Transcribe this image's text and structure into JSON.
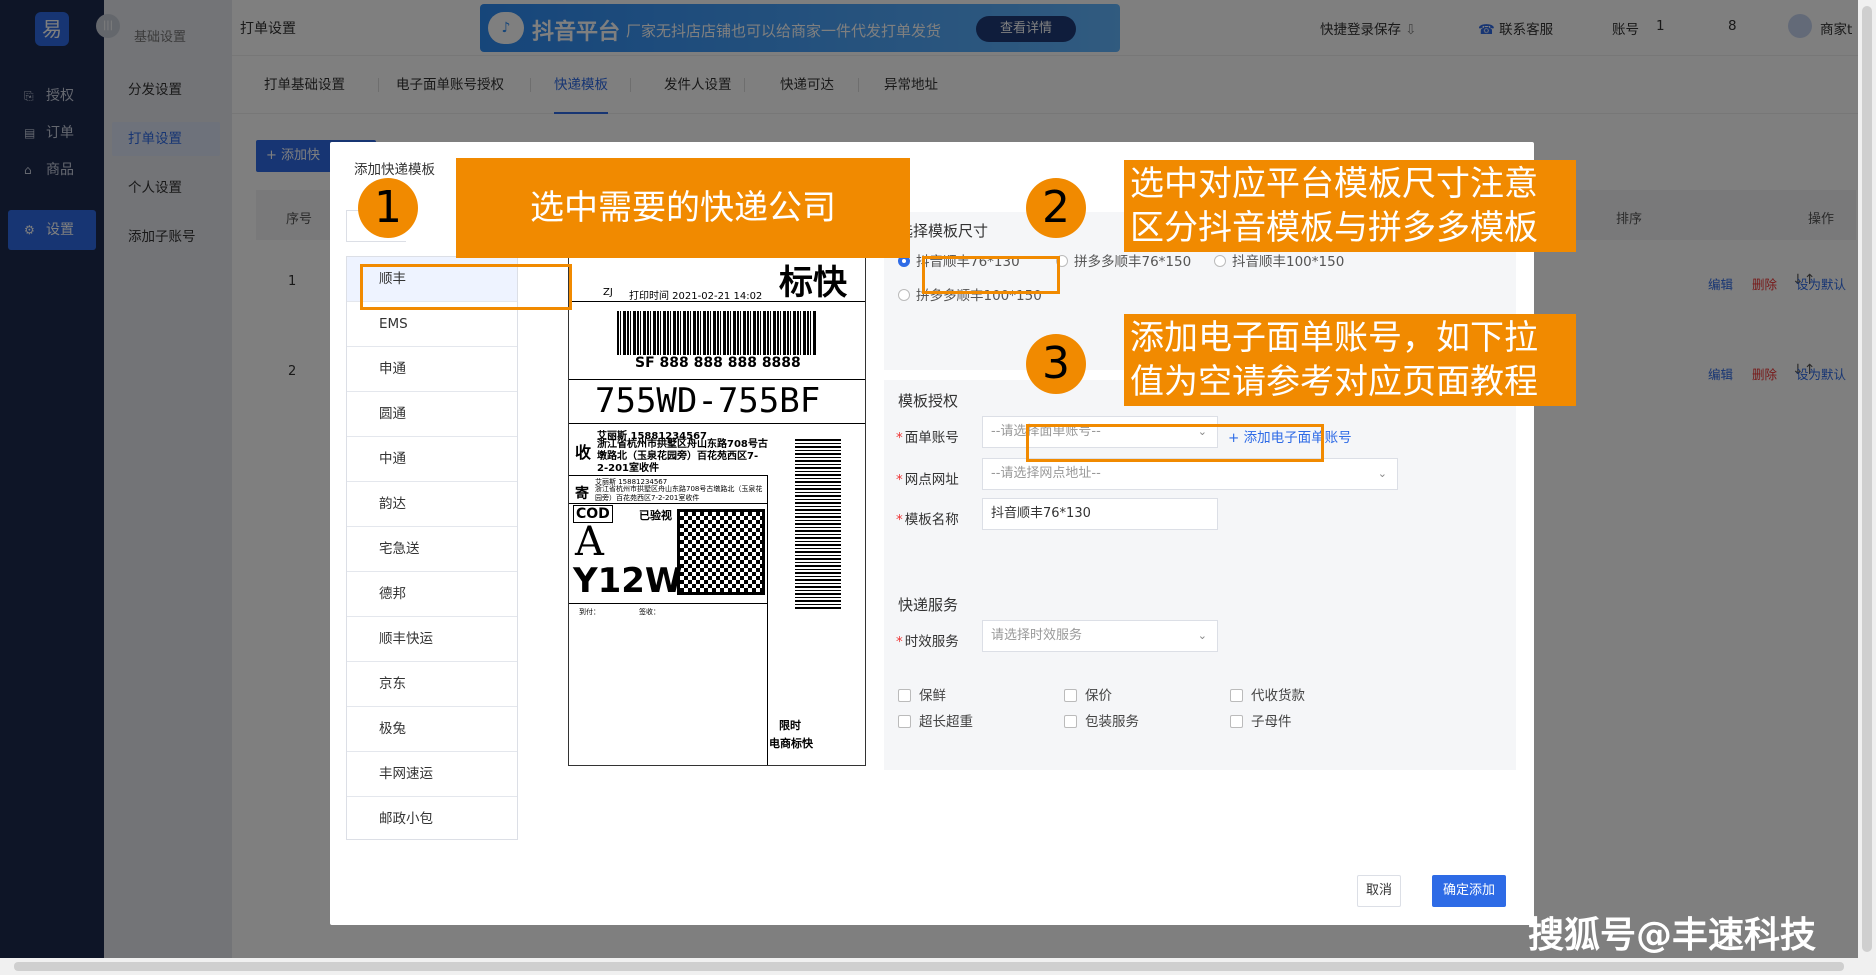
{
  "nav": {
    "logo": "易",
    "items": [
      {
        "label": "授权",
        "icon": "auth-icon"
      },
      {
        "label": "订单",
        "icon": "order-icon"
      },
      {
        "label": "商品",
        "icon": "goods-icon"
      },
      {
        "label": "设置",
        "icon": "settings-icon"
      }
    ],
    "collapse": "|||"
  },
  "subnav": {
    "heading": "基础设置",
    "items": [
      "分发设置",
      "打单设置",
      "个人设置",
      "添加子账号"
    ]
  },
  "header": {
    "title": "打单设置",
    "banner": {
      "title": "抖音平台",
      "text": "厂家无抖店店铺也可以给商家一件代发打单发货",
      "button": "查看详情"
    },
    "quick_login": "快捷登录保存",
    "support": "联系客服",
    "account_label": "账号",
    "account_value": "1",
    "count": "8",
    "user": "商家t"
  },
  "tabs": [
    "打单基础设置",
    "电子面单账号授权",
    "快递模板",
    "发件人设置",
    "快递可达",
    "异常地址"
  ],
  "page": {
    "add_button": "+ 添加快",
    "table_headers": {
      "no": "序号",
      "sort": "排序",
      "ops": "操作"
    },
    "rows": [
      {
        "no": "1",
        "ops": [
          "编辑",
          "删除",
          "设为默认"
        ]
      },
      {
        "no": "2",
        "ops": [
          "编辑",
          "删除",
          "设为默认"
        ]
      }
    ]
  },
  "modal": {
    "title": "添加快递模板",
    "couriers": [
      "顺丰",
      "EMS",
      "申通",
      "圆通",
      "中通",
      "韵达",
      "宅急送",
      "德邦",
      "顺丰快运",
      "京东",
      "极兔",
      "丰网速运",
      "邮政小包"
    ],
    "selected_courier": "顺丰",
    "label_preview": {
      "brand": "标快",
      "zj": "ZJ",
      "print_time": "打印时间 2021-02-21 14:02",
      "tracking": "SF 888 888 888 8888",
      "route": "755WD-755BF",
      "recv_mark": "收",
      "recv_name": "艾丽斯 15881234567",
      "recv_addr": "浙江省杭州市拱墅区舟山东路708号古墩路北（玉泉花园旁）百花苑西区7-2-201室收件",
      "send_mark": "寄",
      "send_name": "艾丽斯 15881234567",
      "send_addr": "浙江省杭州市拱墅区舟山东路708号古墩路北（玉泉花园旁）百花苑西区7-2-201室收件",
      "cod": "COD",
      "verified": "已验视",
      "letter": "A",
      "code": "Y12W",
      "arrive": "到付：",
      "sign": "签收：",
      "limit": "限时",
      "ecom": "电商标快"
    },
    "size_section": {
      "title": "选择模板尺寸",
      "options": [
        "抖音顺丰76*130",
        "拼多多顺丰76*150",
        "抖音顺丰100*150",
        "拼多多顺丰100*150"
      ],
      "selected": "抖音顺丰76*130"
    },
    "auth_section": {
      "title": "模板授权",
      "account_label": "面单账号",
      "account_placeholder": "--请选择面单账号--",
      "add_account": "添加电子面单账号",
      "outlet_label": "网点网址",
      "outlet_placeholder": "--请选择网点地址--",
      "name_label": "模板名称",
      "name_value": "抖音顺丰76*130"
    },
    "service_section": {
      "title": "快递服务",
      "time_label": "时效服务",
      "time_placeholder": "请选择时效服务",
      "checks": [
        "保鲜",
        "保价",
        "代收货款",
        "超长超重",
        "包装服务",
        "子母件"
      ]
    },
    "cancel": "取消",
    "confirm": "确定添加"
  },
  "annotations": {
    "n1": "1",
    "note1": "选中需要的快递公司",
    "n2": "2",
    "note2_line1": "选中对应平台模板尺寸注意",
    "note2_line2": "区分抖音模板与拼多多模板",
    "n3": "3",
    "note3_line1": "添加电子面单账号，如下拉",
    "note3_line2": "值为空请参考对应页面教程"
  },
  "watermark": "搜狐号@丰速科技",
  "colors": {
    "accent": "#2e6be6",
    "annotation": "#f18a00",
    "nav_bg": "#1c2a4f"
  }
}
